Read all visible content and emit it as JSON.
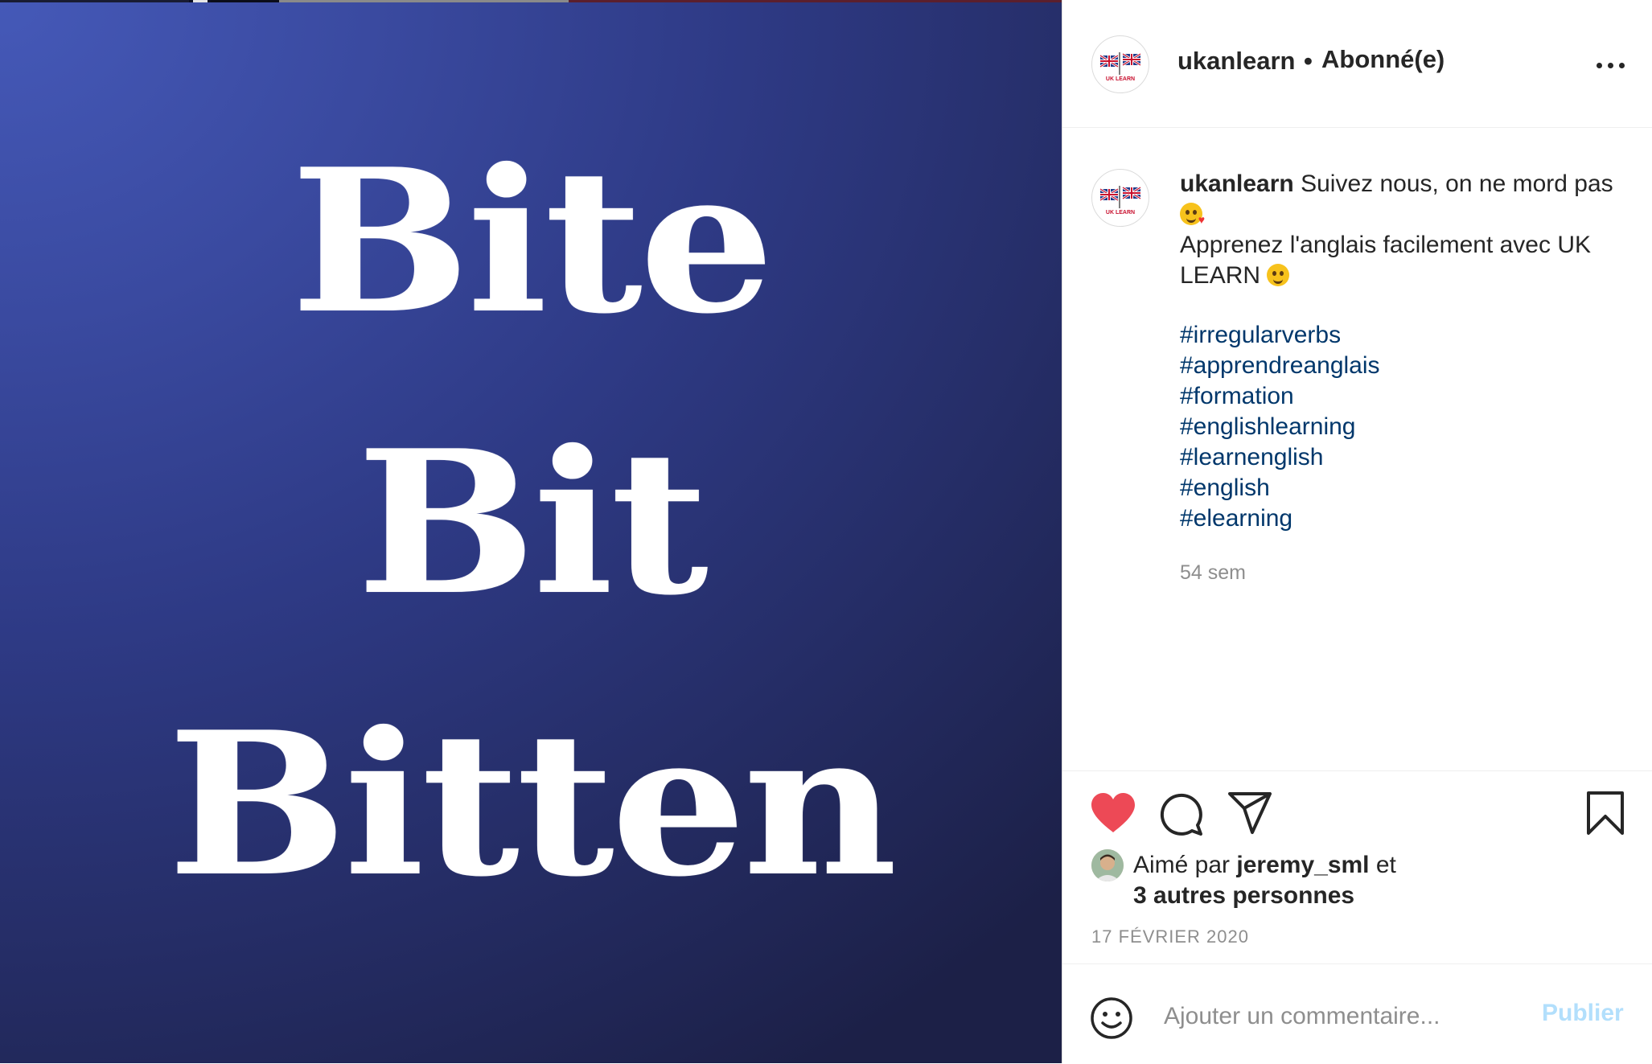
{
  "post_image": {
    "lines": [
      "Bite",
      "Bit",
      "Bitten"
    ]
  },
  "header": {
    "username": "ukanlearn",
    "separator": "•",
    "follow_status": "Abonné(e)",
    "avatar_text": "UK LEARN"
  },
  "caption": {
    "username": "ukanlearn",
    "line1": "Suivez nous, on ne mord pas",
    "line2_part1": "Apprenez l'anglais facilement avec UK",
    "line2_part2": "LEARN"
  },
  "hashtags": [
    "#irregularverbs",
    "#apprendreanglais",
    "#formation",
    "#englishlearning",
    "#learnenglish",
    "#english",
    "#elearning"
  ],
  "time_ago": "54 sem",
  "likes": {
    "prefix": "Aimé par",
    "user": "jeremy_sml",
    "conj": "et",
    "others": "3 autres personnes"
  },
  "date": "17 FÉVRIER 2020",
  "comment": {
    "placeholder": "Ajouter un commentaire...",
    "publish_label": "Publier"
  },
  "colors": {
    "heart": "#ed4956",
    "hashtag": "#00376b",
    "publish_disabled": "#b2dffc"
  },
  "icons": [
    "heart-icon",
    "comment-icon",
    "share-icon",
    "bookmark-icon",
    "emoji-icon",
    "more-options-icon"
  ]
}
